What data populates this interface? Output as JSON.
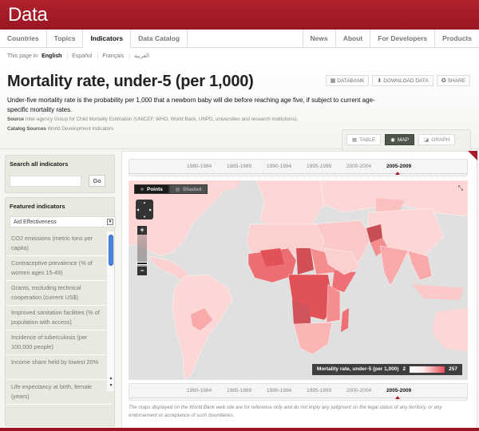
{
  "brand": "Data",
  "colors": {
    "brand_red": "#a51d2a",
    "panel_green": "#e6eadf",
    "active_tab": "#505549"
  },
  "nav": {
    "left": [
      {
        "label": "Countries",
        "active": false
      },
      {
        "label": "Topics",
        "active": false
      },
      {
        "label": "Indicators",
        "active": true
      },
      {
        "label": "Data Catalog",
        "active": false
      }
    ],
    "right": [
      {
        "label": "News"
      },
      {
        "label": "About"
      },
      {
        "label": "For Developers"
      },
      {
        "label": "Products"
      }
    ]
  },
  "languages": {
    "prefix": "This page in",
    "items": [
      "English",
      "Español",
      "Français",
      "العربية"
    ],
    "current": "English"
  },
  "header": {
    "title": "Mortality rate, under-5 (per 1,000)",
    "actions": [
      {
        "label": "DATABANK",
        "icon": "databank-icon"
      },
      {
        "label": "DOWNLOAD DATA",
        "icon": "download-icon"
      },
      {
        "label": "SHARE",
        "icon": "share-icon"
      }
    ],
    "description": "Under-five mortality rate is the probability per 1,000 that a newborn baby will die before reaching age five, if subject to current age-specific mortality rates.",
    "source_label": "Source",
    "source_text": "Inter-agency Group for Child Mortality Estimation (UNICEF, WHO, World Bank, UNPD, universities and research institutions).",
    "catalog_label": "Catalog Sources",
    "catalog_text": "World Development Indicators"
  },
  "view_tabs": [
    {
      "label": "TABLE",
      "icon": "table-icon",
      "active": false
    },
    {
      "label": "MAP",
      "icon": "globe-icon",
      "active": true
    },
    {
      "label": "GRAPH",
      "icon": "graph-icon",
      "active": false
    }
  ],
  "sidebar": {
    "search_title": "Search all indicators",
    "search_value": "",
    "go_label": "Go",
    "featured_title": "Featured indicators",
    "selected_category": "Aid Effectiveness",
    "indicators": [
      "CO2 emissions (metric tons per capita)",
      "Contraceptive prevalence (% of women ages 15-49)",
      "Grants, excluding technical cooperation (current US$)",
      "Improved sanitation facilities (% of population with access)",
      "Incidence of tuberculosis (per 100,000 people)",
      "Income share held by lowest 20%",
      "Life expectancy at birth, female (years)"
    ]
  },
  "timeline": {
    "periods": [
      "1980-1984",
      "1985-1989",
      "1990-1994",
      "1995-1999",
      "2000-2004",
      "2005-2009"
    ],
    "active": "2005-2009"
  },
  "map": {
    "modes": [
      {
        "label": "Points",
        "active": true
      },
      {
        "label": "Shaded",
        "active": false
      }
    ],
    "legend_title": "Mortality rate, under-5 (per 1,000)",
    "legend_min": "2",
    "legend_max": "257"
  },
  "disclaimer": "The maps displayed on the World Bank web site are for reference only and do not imply any judgment on the legal status of any territory, or any endorsement or acceptance of such boundaries."
}
